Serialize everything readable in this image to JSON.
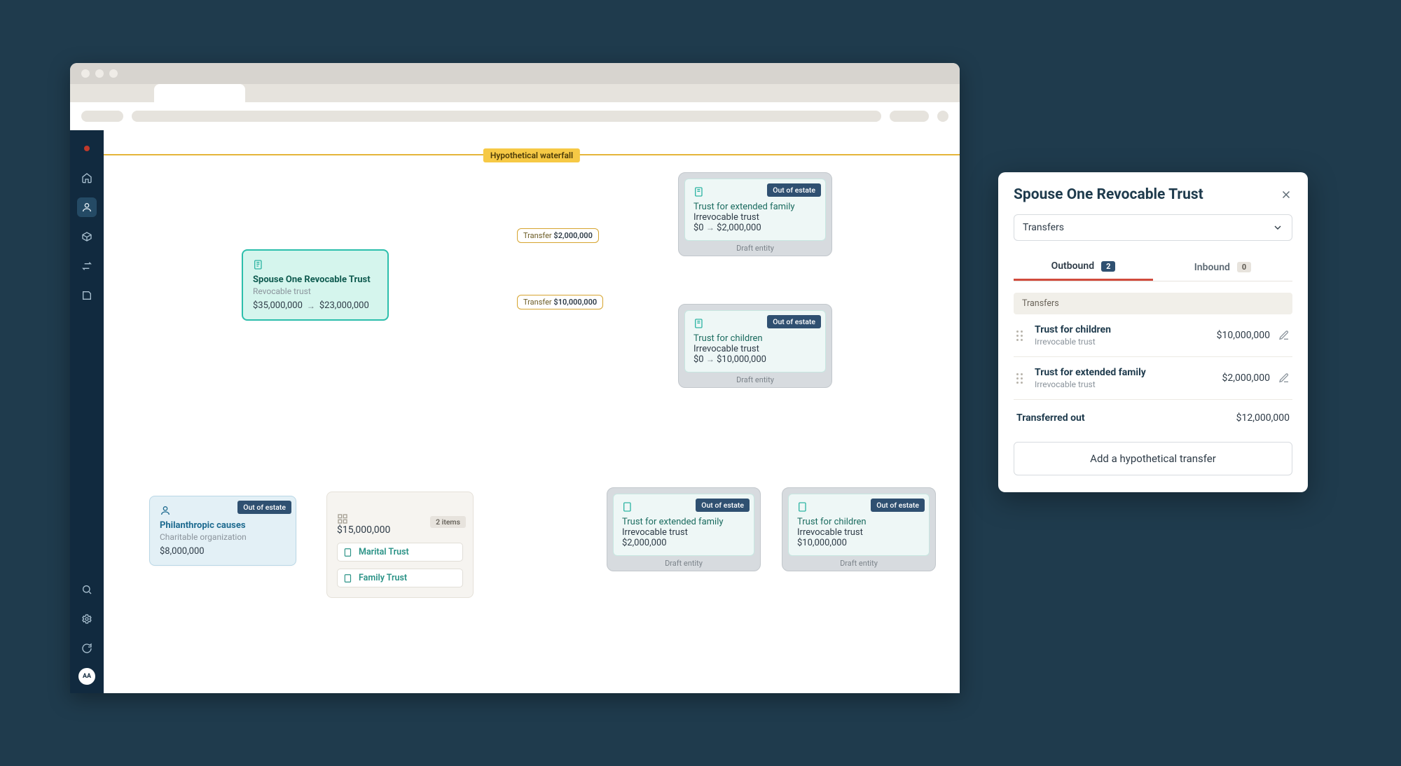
{
  "banner": "Hypothetical waterfall",
  "sidebar": {
    "avatar": "AA"
  },
  "transfers": {
    "t1": {
      "label": "Transfer",
      "amount": "$2,000,000"
    },
    "t2": {
      "label": "Transfer",
      "amount": "$10,000,000"
    }
  },
  "entities": {
    "source": {
      "title": "Spouse One Revocable Trust",
      "subtitle": "Revocable trust",
      "from": "$35,000,000",
      "to": "$23,000,000"
    },
    "extended1": {
      "title": "Trust for extended family",
      "subtitle": "Irrevocable trust",
      "from": "$0",
      "to": "$2,000,000",
      "badge": "Out of estate",
      "draft": "Draft entity"
    },
    "children1": {
      "title": "Trust for children",
      "subtitle": "Irrevocable trust",
      "from": "$0",
      "to": "$10,000,000",
      "badge": "Out of estate",
      "draft": "Draft entity"
    },
    "phil": {
      "title": "Philanthropic causes",
      "subtitle": "Charitable organization",
      "value": "$8,000,000",
      "badge": "Out of estate"
    },
    "group": {
      "value": "$15,000,000",
      "badge": "2 items",
      "item1": "Marital Trust",
      "item2": "Family Trust"
    },
    "extended2": {
      "title": "Trust for extended family",
      "subtitle": "Irrevocable trust",
      "value": "$2,000,000",
      "badge": "Out of estate",
      "draft": "Draft entity"
    },
    "children2": {
      "title": "Trust for children",
      "subtitle": "Irrevocable trust",
      "value": "$10,000,000",
      "badge": "Out of estate",
      "draft": "Draft entity"
    }
  },
  "panel": {
    "title": "Spouse One Revocable Trust",
    "select": "Transfers",
    "tabs": {
      "outbound": {
        "label": "Outbound",
        "count": "2"
      },
      "inbound": {
        "label": "Inbound",
        "count": "0"
      }
    },
    "section": "Transfers",
    "rows": [
      {
        "title": "Trust for children",
        "sub": "Irrevocable trust",
        "amount": "$10,000,000"
      },
      {
        "title": "Trust for extended family",
        "sub": "Irrevocable trust",
        "amount": "$2,000,000"
      }
    ],
    "total": {
      "label": "Transferred out",
      "amount": "$12,000,000"
    },
    "button": "Add a hypothetical transfer"
  }
}
